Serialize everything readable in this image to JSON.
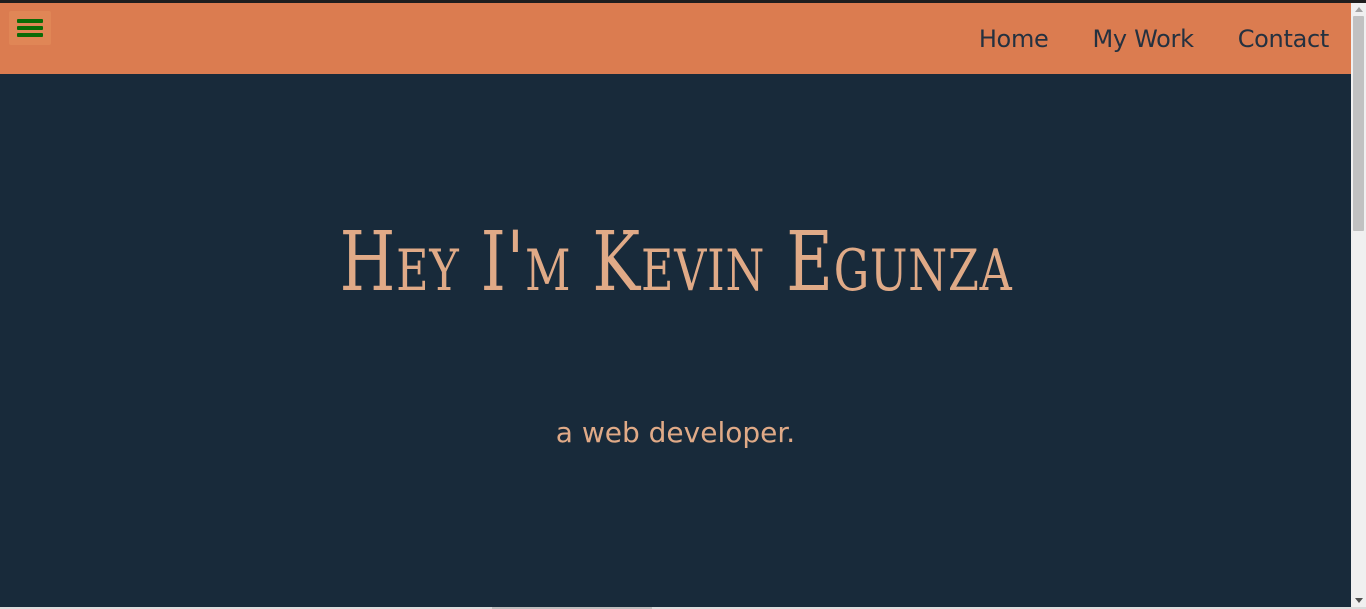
{
  "header": {
    "menu_icon": "hamburger-menu-icon",
    "nav": [
      {
        "label": "Home"
      },
      {
        "label": "My Work"
      },
      {
        "label": "Contact"
      }
    ]
  },
  "hero": {
    "title": "Hey I'm Kevin Egunza",
    "subtitle": "a web developer."
  },
  "colors": {
    "navbar": "#db7c50",
    "background": "#182a3a",
    "accent_text": "#e0aa87",
    "nav_text": "#243140",
    "menu_icon": "#0b6b06"
  }
}
